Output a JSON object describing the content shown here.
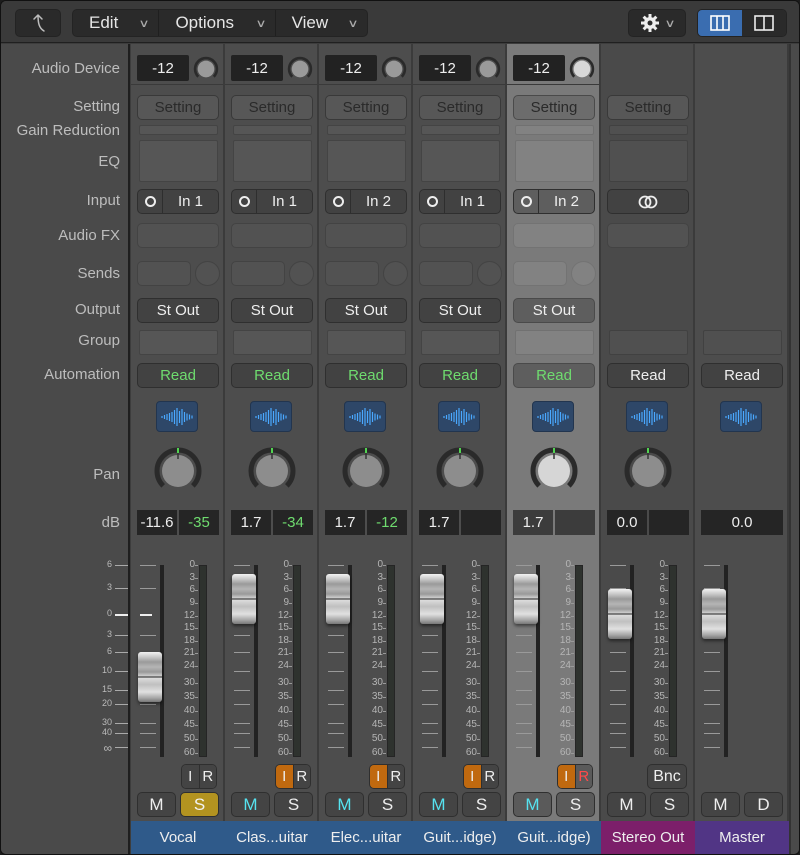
{
  "toolbar": {
    "back_icon": "back-arrow-icon",
    "menus": [
      {
        "label": "Edit"
      },
      {
        "label": "Options"
      },
      {
        "label": "View"
      }
    ],
    "gear_icon": "gear-icon",
    "view_modes": [
      {
        "icon": "three-column-icon",
        "active": true
      },
      {
        "icon": "two-column-icon",
        "active": false
      }
    ]
  },
  "row_labels": {
    "audio_device": "Audio Device",
    "setting": "Setting",
    "gain_reduction": "Gain Reduction",
    "eq": "EQ",
    "input": "Input",
    "audio_fx": "Audio FX",
    "sends": "Sends",
    "output": "Output",
    "group": "Group",
    "automation": "Automation",
    "pan": "Pan",
    "db": "dB"
  },
  "fader_scale": [
    "6",
    "3",
    "0",
    "3",
    "6",
    "10",
    "15",
    "20",
    "30",
    "40",
    "∞"
  ],
  "meter_scale": [
    "0",
    "3",
    "6",
    "9",
    "12",
    "15",
    "18",
    "21",
    "24",
    "30",
    "35",
    "40",
    "45",
    "50",
    "60"
  ],
  "strips": [
    {
      "name": "Vocal",
      "name_color": "#2f5a8a",
      "selected": false,
      "type": "audio",
      "audio_device_gain": "-12",
      "setting": "Setting",
      "input_label": "In 1",
      "output": "St Out",
      "automation": "Read",
      "automation_color": "#6fdc6f",
      "volume_db": "-11.6",
      "peak_db": "-35",
      "fader_db": -11.6,
      "input_monitor": false,
      "record_enable": false,
      "mute": "M",
      "solo": "S",
      "mute_active": false,
      "solo_active": true,
      "i_label": "I",
      "r_label": "R"
    },
    {
      "name": "Clas...uitar",
      "name_color": "#2f5a8a",
      "selected": false,
      "type": "audio",
      "audio_device_gain": "-12",
      "setting": "Setting",
      "input_label": "In 1",
      "output": "St Out",
      "automation": "Read",
      "automation_color": "#6fdc6f",
      "volume_db": "1.7",
      "peak_db": "-34",
      "fader_db": 1.7,
      "input_monitor": true,
      "record_enable": false,
      "mute": "M",
      "solo": "S",
      "mute_active": true,
      "solo_active": false,
      "i_label": "I",
      "r_label": "R"
    },
    {
      "name": "Elec...uitar",
      "name_color": "#2f5a8a",
      "selected": false,
      "type": "audio",
      "audio_device_gain": "-12",
      "setting": "Setting",
      "input_label": "In 2",
      "output": "St Out",
      "automation": "Read",
      "automation_color": "#6fdc6f",
      "volume_db": "1.7",
      "peak_db": "-12",
      "fader_db": 1.7,
      "input_monitor": true,
      "record_enable": false,
      "mute": "M",
      "solo": "S",
      "mute_active": true,
      "solo_active": false,
      "i_label": "I",
      "r_label": "R"
    },
    {
      "name": "Guit...idge)",
      "name_color": "#2f5a8a",
      "selected": false,
      "type": "audio",
      "audio_device_gain": "-12",
      "setting": "Setting",
      "input_label": "In 1",
      "output": "St Out",
      "automation": "Read",
      "automation_color": "#6fdc6f",
      "volume_db": "1.7",
      "peak_db": "",
      "fader_db": 1.7,
      "input_monitor": true,
      "record_enable": false,
      "mute": "M",
      "solo": "S",
      "mute_active": true,
      "solo_active": false,
      "i_label": "I",
      "r_label": "R"
    },
    {
      "name": "Guit...idge)",
      "name_color": "#2f5a8a",
      "selected": true,
      "type": "audio",
      "audio_device_gain": "-12",
      "setting": "Setting",
      "input_label": "In 2",
      "output": "St Out",
      "automation": "Read",
      "automation_color": "#6fdc6f",
      "volume_db": "1.7",
      "peak_db": "",
      "fader_db": 1.7,
      "input_monitor": true,
      "record_enable": true,
      "mute": "M",
      "solo": "S",
      "mute_active": true,
      "solo_active": false,
      "i_label": "I",
      "r_label": "R"
    },
    {
      "name": "Stereo Out",
      "name_color": "#7c1f6a",
      "selected": false,
      "type": "output",
      "setting": "Setting",
      "input_icon": "stereo-link-icon",
      "automation": "Read",
      "automation_color": "#eeeeee",
      "volume_db": "0.0",
      "peak_db": "",
      "fader_db": 0.0,
      "bounce": "Bnc",
      "mute": "M",
      "solo": "S",
      "mute_active": false,
      "solo_active": false
    },
    {
      "name": "Master",
      "name_color": "#513585",
      "selected": false,
      "type": "master",
      "automation": "Read",
      "automation_color": "#eeeeee",
      "volume_db": "0.0",
      "fader_db": 0.0,
      "mute": "M",
      "dim": "D",
      "mute_active": false
    }
  ]
}
